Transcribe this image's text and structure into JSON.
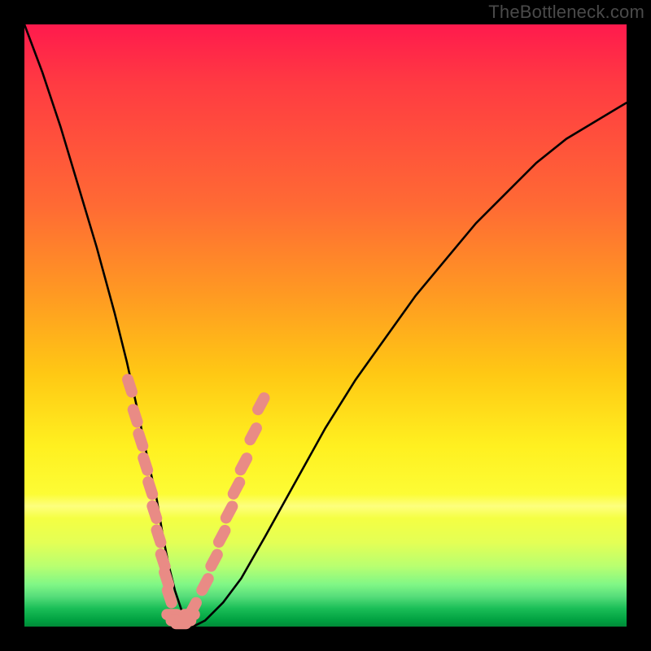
{
  "watermark": "TheBottleneck.com",
  "colors": {
    "frame_bg": "#000000",
    "watermark_text": "#4a4a4a",
    "marker": "#e98b85",
    "curve_stroke": "#000000",
    "gradient_stops": [
      "#ff1a4d",
      "#ff6a34",
      "#ffc814",
      "#fff020",
      "#b8ff70",
      "#00a040"
    ]
  },
  "chart_data": {
    "type": "line",
    "title": "",
    "subtitle": "",
    "xlabel": "",
    "ylabel": "",
    "xlim": [
      0,
      100
    ],
    "ylim": [
      0,
      100
    ],
    "grid": false,
    "legend": false,
    "notes": "V-shaped bottleneck curve. x is an unlabeled normalized axis (0–100). y is bottleneck % (0 at the valley = no bottleneck, 100 at the top = severe). The curve drops steeply from the left, bottoms out near x≈24–28, then rises more slowly toward the right. Background gradient encodes y (red high → green low). Salmon pill-shaped markers cluster on both flanks near the valley (roughly y 8–38%).",
    "series": [
      {
        "name": "bottleneck-curve",
        "x": [
          0,
          3,
          6,
          9,
          12,
          15,
          17,
          19,
          20,
          22,
          23,
          24,
          25,
          26,
          27,
          28,
          30,
          33,
          36,
          40,
          45,
          50,
          55,
          60,
          65,
          70,
          75,
          80,
          85,
          90,
          95,
          100
        ],
        "y": [
          100,
          92,
          83,
          73,
          63,
          52,
          44,
          35,
          30,
          21,
          15,
          10,
          6,
          3,
          1,
          0,
          1,
          4,
          8,
          15,
          24,
          33,
          41,
          48,
          55,
          61,
          67,
          72,
          77,
          81,
          84,
          87
        ]
      }
    ],
    "markers": {
      "description": "Salmon rounded-pill markers placed along the curve near the valley",
      "left_cluster_x": [
        17.5,
        18.4,
        19.3,
        20.1,
        20.9,
        21.6,
        22.3,
        23.0,
        23.6,
        24.1
      ],
      "left_cluster_y": [
        40,
        35,
        31,
        27,
        23,
        19,
        15,
        11,
        8,
        5
      ],
      "right_cluster_x": [
        28.0,
        30.0,
        31.5,
        32.8,
        34.0,
        35.2,
        36.4,
        38.0,
        39.3
      ],
      "right_cluster_y": [
        3,
        7,
        11,
        15,
        19,
        23,
        27,
        32,
        37
      ],
      "valley_x": [
        24.5,
        25.2,
        26.0,
        26.8,
        27.4
      ],
      "valley_y": [
        2,
        1,
        0.5,
        1,
        2
      ]
    }
  }
}
